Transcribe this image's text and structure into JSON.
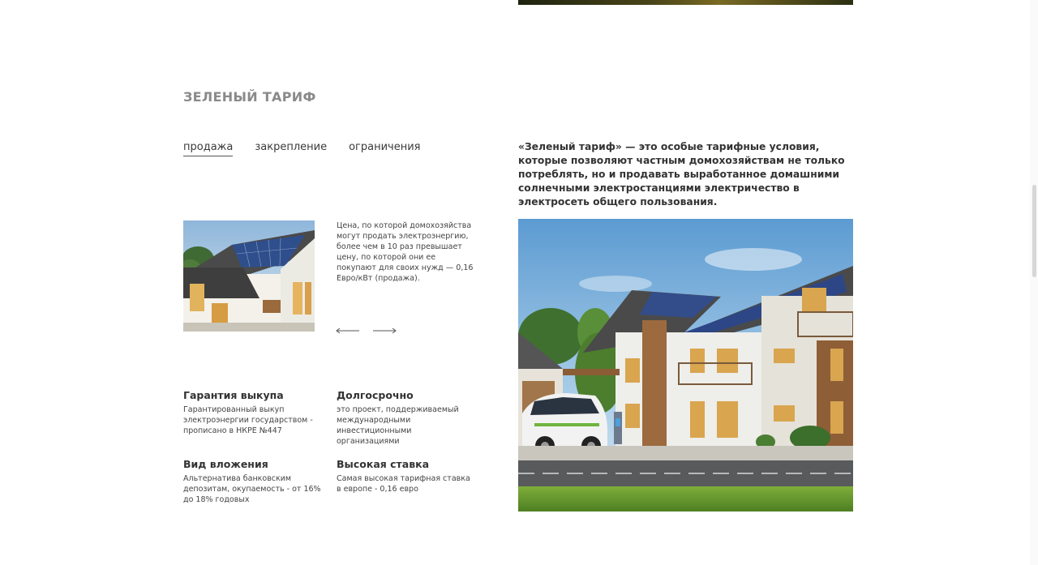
{
  "section": {
    "title": "ЗЕЛЕНЫЙ ТАРИФ"
  },
  "tabs": [
    {
      "label": "продажа",
      "active": true
    },
    {
      "label": "закрепление",
      "active": false
    },
    {
      "label": "ограничения",
      "active": false
    }
  ],
  "slider": {
    "text": "Цена, по которой домохозяйства могут продать электроэнергию, более чем в 10 раз превышает цену, по которой они ее покупают для своих нужд — 0,16 Евро/кВт (продажа).",
    "prev_icon": "arrow-left-icon",
    "next_icon": "arrow-right-icon"
  },
  "features": [
    {
      "title": "Гарантия выкупа",
      "text": "Гарантированный выкуп электроэнергии государством - прописано в НКРЕ №447"
    },
    {
      "title": "Долгосрочно",
      "text": "это проект, поддерживаемый международными инвестиционными организациями"
    },
    {
      "title": "Вид вложения",
      "text": "Альтернатива банковским депозитам, окупаемость - от 16% до 18% годовых"
    },
    {
      "title": "Высокая ставка",
      "text": "Самая высокая тарифная ставка в европе - 0,16 евро"
    }
  ],
  "intro": {
    "text": "«Зеленый тариф» — это особые тарифные условия, которые позволяют частным домохозяйствам не только потреблять, но и продавать выработанное домашними солнечными электростанциями электричество в электросеть общего пользования."
  },
  "colors": {
    "title_gray": "#8a8a8a",
    "text_dark": "#333333",
    "background": "#ffffff"
  }
}
